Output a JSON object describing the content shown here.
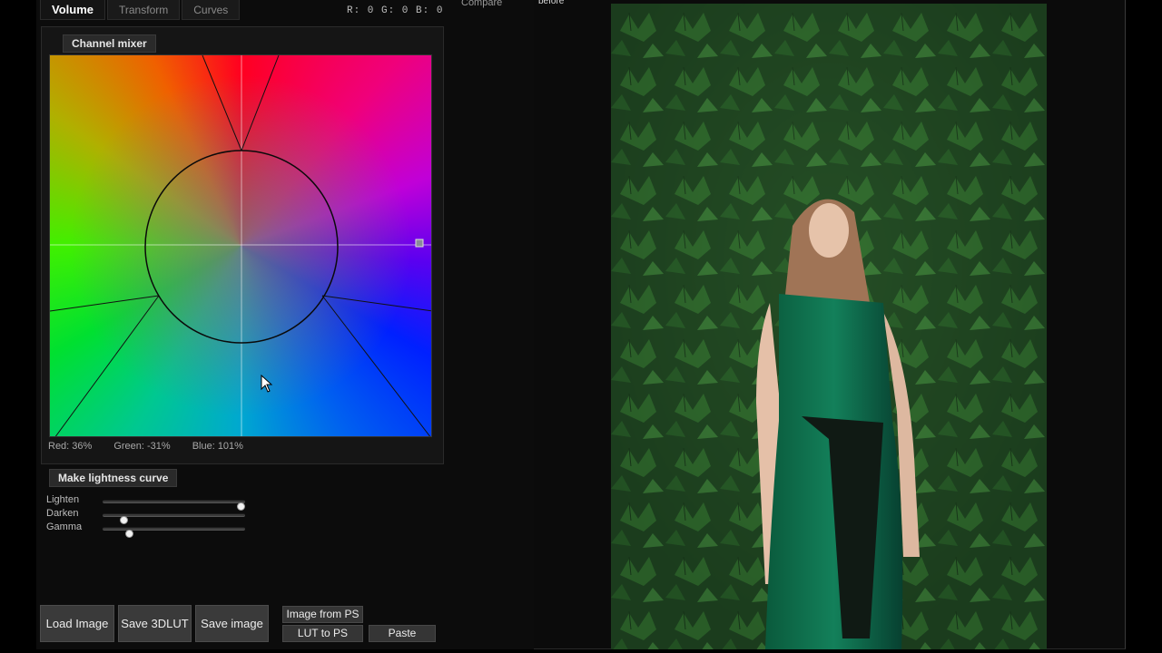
{
  "tabs": [
    {
      "label": "Volume",
      "active": true
    },
    {
      "label": "Transform",
      "active": false
    },
    {
      "label": "Curves",
      "active": false
    }
  ],
  "readout": "R: 0  G: 0  B: 0",
  "header": {
    "compare": "Compare",
    "before": "before"
  },
  "channel_mixer": {
    "title": "Channel mixer",
    "values": {
      "red": "Red:  36%",
      "green": "Green: -31%",
      "blue": "Blue:  101%"
    }
  },
  "lightness": {
    "button": "Make lightness curve",
    "sliders": [
      {
        "label": "Lighten",
        "value": 1.0
      },
      {
        "label": "Darken",
        "value": 0.13
      },
      {
        "label": "Gamma",
        "value": 0.17
      }
    ]
  },
  "buttons": {
    "load_image": "Load Image",
    "save_3dlut": "Save 3DLUT",
    "save_image": "Save image",
    "image_from_ps": "Image from PS",
    "lut_to_ps": "LUT to PS",
    "paste": "Paste"
  },
  "colors": {
    "accent": "#ffffff",
    "panel": "#151515",
    "button": "#3a3a3a",
    "foliage": "#1e4a24",
    "dress": "#0f6a4a"
  }
}
